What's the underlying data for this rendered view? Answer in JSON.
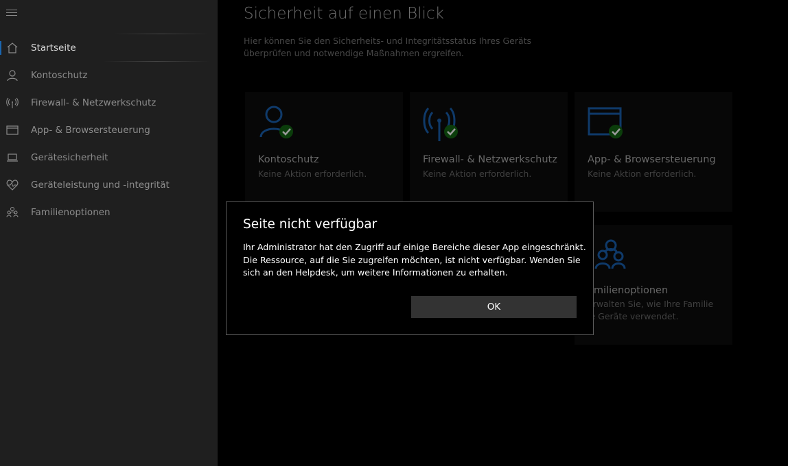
{
  "sidebar": {
    "menu_icon": "hamburger-icon",
    "items": [
      {
        "label": "Startseite",
        "icon": "home-icon",
        "active": true
      },
      {
        "label": "Kontoschutz",
        "icon": "person-icon"
      },
      {
        "label": "Firewall- & Netzwerkschutz",
        "icon": "antenna-icon"
      },
      {
        "label": "App- & Browsersteuerung",
        "icon": "window-icon"
      },
      {
        "label": "Gerätesicherheit",
        "icon": "laptop-icon"
      },
      {
        "label": "Geräteleistung und -integrität",
        "icon": "heart-icon"
      },
      {
        "label": "Familienoptionen",
        "icon": "family-icon"
      }
    ]
  },
  "main": {
    "title": "Sicherheit auf einen Blick",
    "description": "Hier können Sie den Sicherheits- und Integritätsstatus Ihres Geräts überprüfen und notwendige Maßnahmen ergreifen.",
    "tiles": [
      {
        "title": "Kontoschutz",
        "status": "Keine Aktion erforderlich.",
        "icon": "person-check-icon"
      },
      {
        "title": "Firewall- & Netzwerkschutz",
        "status": "Keine Aktion erforderlich.",
        "icon": "antenna-check-icon"
      },
      {
        "title": "App- & Browsersteuerung",
        "status": "Keine Aktion erforderlich.",
        "icon": "window-check-icon"
      },
      {
        "title": "amilienoptionen",
        "status": "erwalten Sie, wie Ihre Familie",
        "status2": "ie Geräte verwendet.",
        "icon": "family-icon"
      }
    ]
  },
  "dialog": {
    "title": "Seite nicht verfügbar",
    "body": "Ihr Administrator hat den Zugriff auf einige Bereiche dieser App eingeschränkt. Die Ressource, auf die Sie zugreifen möchten, ist nicht verfügbar. Wenden Sie sich an den Helpdesk, um weitere Informationen zu erhalten.",
    "ok_label": "OK"
  },
  "colors": {
    "accent": "#1a66b0",
    "check": "#107c10",
    "sidebar_bg": "#1f1f1f"
  }
}
